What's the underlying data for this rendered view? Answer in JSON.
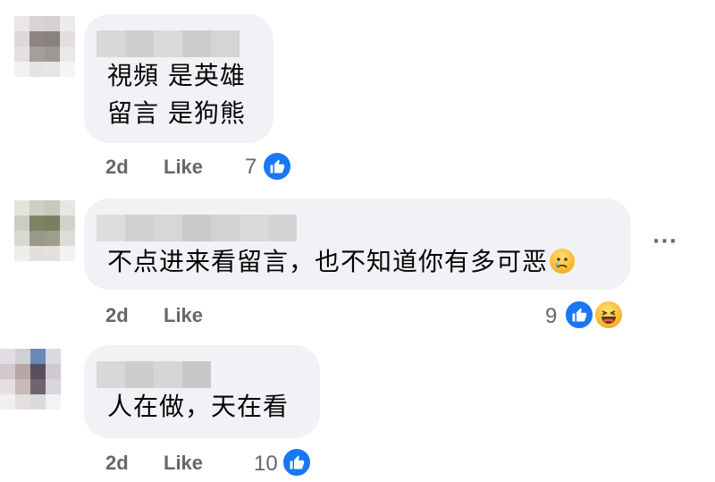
{
  "comments": [
    {
      "lines": [
        "視頻 是英雄",
        "留言 是狗熊"
      ],
      "time": "2d",
      "like_label": "Like",
      "reaction_count": "7"
    },
    {
      "lines": [
        "不点进来看留言，也不知道你有多可恶"
      ],
      "time": "2d",
      "like_label": "Like",
      "reaction_count": "9",
      "more": "···"
    },
    {
      "lines": [
        "人在做，天在看"
      ],
      "time": "2d",
      "like_label": "Like",
      "reaction_count": "10"
    }
  ],
  "colors": {
    "bubble": "#f0f2f5",
    "meta": "#65676b",
    "like_blue": "#1877f2",
    "text": "#050505"
  },
  "icons": [
    "thumbs-up-icon",
    "haha-icon",
    "sad-crying-icon",
    "more-icon"
  ]
}
